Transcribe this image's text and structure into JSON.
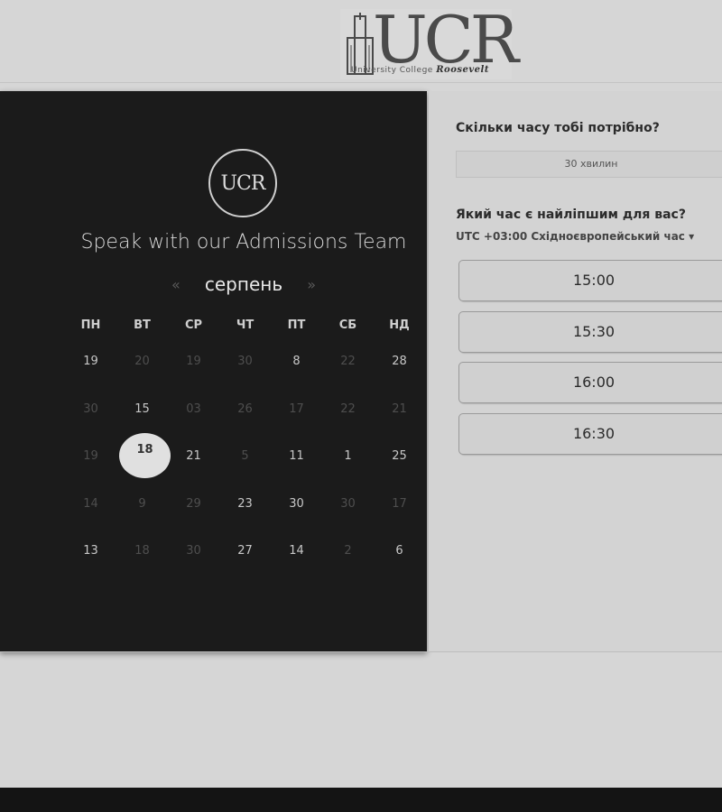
{
  "logo": {
    "letters": "UCR",
    "subtitle": "University College",
    "script": "Roosevelt"
  },
  "panel": {
    "badge": "UCR",
    "heading": "Speak with our Admissions Team",
    "prev_arrow": "«",
    "next_arrow": "»",
    "month": "серпень",
    "weekdays": [
      "ПН",
      "ВТ",
      "СР",
      "ЧТ",
      "ПТ",
      "СБ",
      "НД"
    ],
    "weeks": [
      [
        {
          "d": "19",
          "on": true
        },
        {
          "d": "20",
          "on": false
        },
        {
          "d": "19",
          "on": false
        },
        {
          "d": "30",
          "on": false
        },
        {
          "d": "8",
          "on": true
        },
        {
          "d": "22",
          "on": false
        },
        {
          "d": "28",
          "on": true
        }
      ],
      [
        {
          "d": "30",
          "on": false
        },
        {
          "d": "15",
          "on": true
        },
        {
          "d": "03",
          "on": false
        },
        {
          "d": "26",
          "on": false
        },
        {
          "d": "17",
          "on": false
        },
        {
          "d": "22",
          "on": false
        },
        {
          "d": "21",
          "on": false
        }
      ],
      [
        {
          "d": "19",
          "on": false
        },
        {
          "d": "18",
          "on": true,
          "selected": true
        },
        {
          "d": "21",
          "on": true
        },
        {
          "d": "5",
          "on": false
        },
        {
          "d": "11",
          "on": true
        },
        {
          "d": "1",
          "on": true
        },
        {
          "d": "25",
          "on": true
        }
      ],
      [
        {
          "d": "14",
          "on": false
        },
        {
          "d": "9",
          "on": false
        },
        {
          "d": "29",
          "on": false
        },
        {
          "d": "23",
          "on": true
        },
        {
          "d": "30",
          "on": true
        },
        {
          "d": "30",
          "on": false
        },
        {
          "d": "17",
          "on": false
        }
      ],
      [
        {
          "d": "13",
          "on": true
        },
        {
          "d": "18",
          "on": false
        },
        {
          "d": "30",
          "on": false
        },
        {
          "d": "27",
          "on": true
        },
        {
          "d": "14",
          "on": true
        },
        {
          "d": "2",
          "on": false
        },
        {
          "d": "6",
          "on": true
        }
      ]
    ]
  },
  "right": {
    "q_duration": "Скільки часу тобі потрібно?",
    "duration_value": "30 хвилин",
    "q_time": "Який час є найліпшим для вас?",
    "timezone": "UTC +03:00 Східноєвропейський час",
    "timezone_caret": "▾",
    "slots": [
      "15:00",
      "15:30",
      "16:00",
      "16:30"
    ]
  }
}
